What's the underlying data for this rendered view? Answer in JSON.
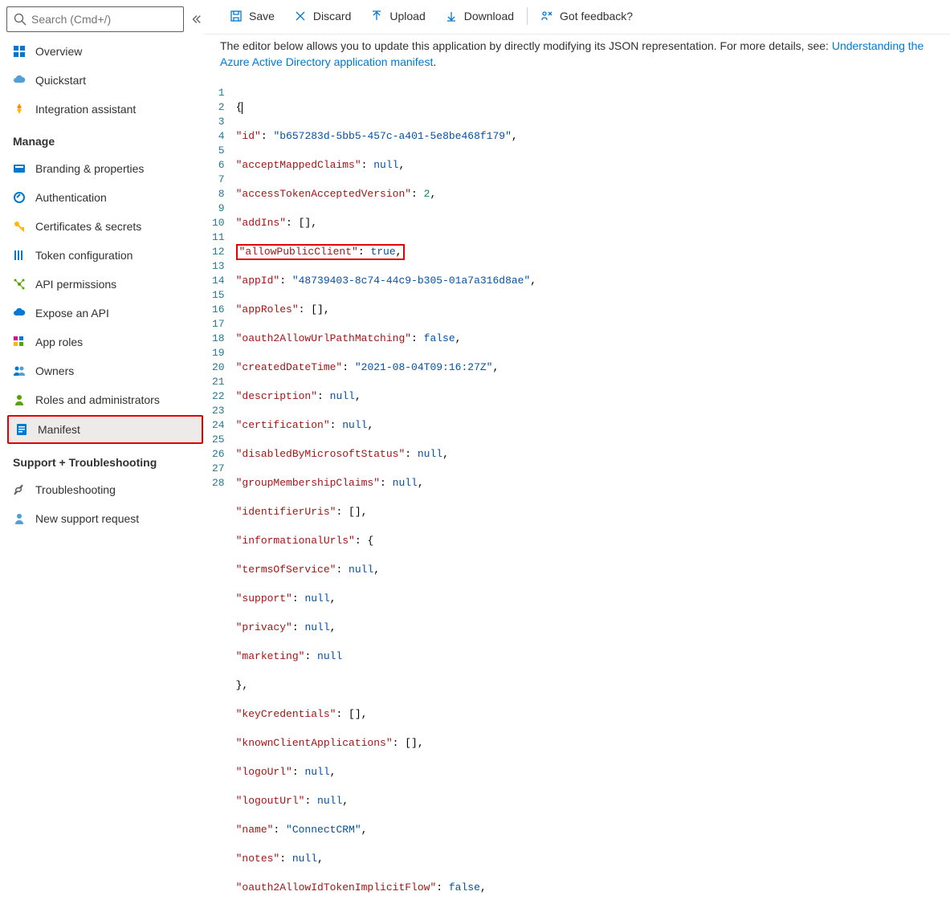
{
  "search": {
    "placeholder": "Search (Cmd+/)"
  },
  "nav": {
    "overview": "Overview",
    "quickstart": "Quickstart",
    "integration": "Integration assistant"
  },
  "sections": {
    "manage": "Manage",
    "support": "Support + Troubleshooting"
  },
  "manage": {
    "branding": "Branding & properties",
    "auth": "Authentication",
    "certs": "Certificates & secrets",
    "token": "Token configuration",
    "api": "API permissions",
    "expose": "Expose an API",
    "roles": "App roles",
    "owners": "Owners",
    "rolesadmin": "Roles and administrators",
    "manifest": "Manifest"
  },
  "support": {
    "trouble": "Troubleshooting",
    "newreq": "New support request"
  },
  "toolbar": {
    "save": "Save",
    "discard": "Discard",
    "upload": "Upload",
    "download": "Download",
    "feedback": "Got feedback?"
  },
  "desc": {
    "pre": "The editor below allows you to update this application by directly modifying its JSON representation. For more details, see: ",
    "link": "Understanding the Azure Active Directory application manifest",
    "post": "."
  },
  "code": {
    "id_k": "\"id\"",
    "id_v": "\"b657283d-5bb5-457c-a401-5e8be468f179\"",
    "amc_k": "\"acceptMappedClaims\"",
    "null": "null",
    "atav_k": "\"accessTokenAcceptedVersion\"",
    "two": "2",
    "addins_k": "\"addIns\"",
    "apc_k": "\"allowPublicClient\"",
    "true": "true",
    "appid_k": "\"appId\"",
    "appid_v": "\"48739403-8c74-44c9-b305-01a7a316d8ae\"",
    "approles_k": "\"appRoles\"",
    "o2pm_k": "\"oauth2AllowUrlPathMatching\"",
    "false": "false",
    "cdt_k": "\"createdDateTime\"",
    "cdt_v": "\"2021-08-04T09:16:27Z\"",
    "desc_k": "\"description\"",
    "cert_k": "\"certification\"",
    "dms_k": "\"disabledByMicrosoftStatus\"",
    "gmc_k": "\"groupMembershipClaims\"",
    "idu_k": "\"identifierUris\"",
    "infu_k": "\"informationalUrls\"",
    "tos_k": "\"termsOfService\"",
    "sup_k": "\"support\"",
    "priv_k": "\"privacy\"",
    "mkt_k": "\"marketing\"",
    "kc_k": "\"keyCredentials\"",
    "kca_k": "\"knownClientApplications\"",
    "logo_k": "\"logoUrl\"",
    "logout_k": "\"logoutUrl\"",
    "name_k": "\"name\"",
    "name_v": "\"ConnectCRM\"",
    "notes_k": "\"notes\"",
    "o2if_k": "\"oauth2AllowIdTokenImplicitFlow\""
  }
}
